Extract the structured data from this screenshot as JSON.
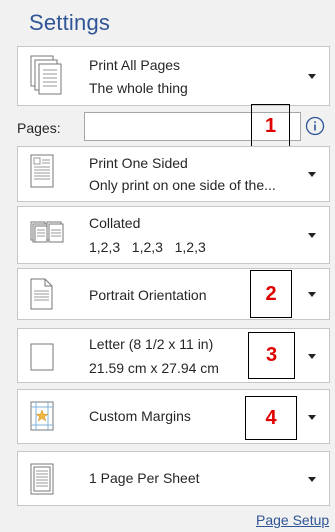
{
  "title": "Settings",
  "print_pages": {
    "line1": "Print All Pages",
    "line2": "The whole thing"
  },
  "pages_field": {
    "label": "Pages:",
    "value": "",
    "placeholder": ""
  },
  "sides": {
    "line1": "Print One Sided",
    "line2": "Only print on one side of the..."
  },
  "collation": {
    "line1": "Collated",
    "line2": "1,2,3   1,2,3   1,2,3"
  },
  "orientation": {
    "line1": "Portrait Orientation"
  },
  "paper": {
    "line1": "Letter (8 1/2 x 11 in)",
    "line2": "21.59 cm x 27.94 cm"
  },
  "margins": {
    "line1": "Custom Margins"
  },
  "pages_per_sheet": {
    "line1": "1 Page Per Sheet"
  },
  "page_setup_link": "Page Setup",
  "callouts": [
    "1",
    "2",
    "3",
    "4"
  ],
  "colors": {
    "accent": "#2f5597",
    "callout": "#e00000"
  },
  "icons": [
    "pages-stack-icon",
    "info-icon",
    "one-sided-icon",
    "collated-icon",
    "portrait-icon",
    "paper-size-icon",
    "margins-icon",
    "page-per-sheet-icon",
    "chevron-down-icon"
  ]
}
